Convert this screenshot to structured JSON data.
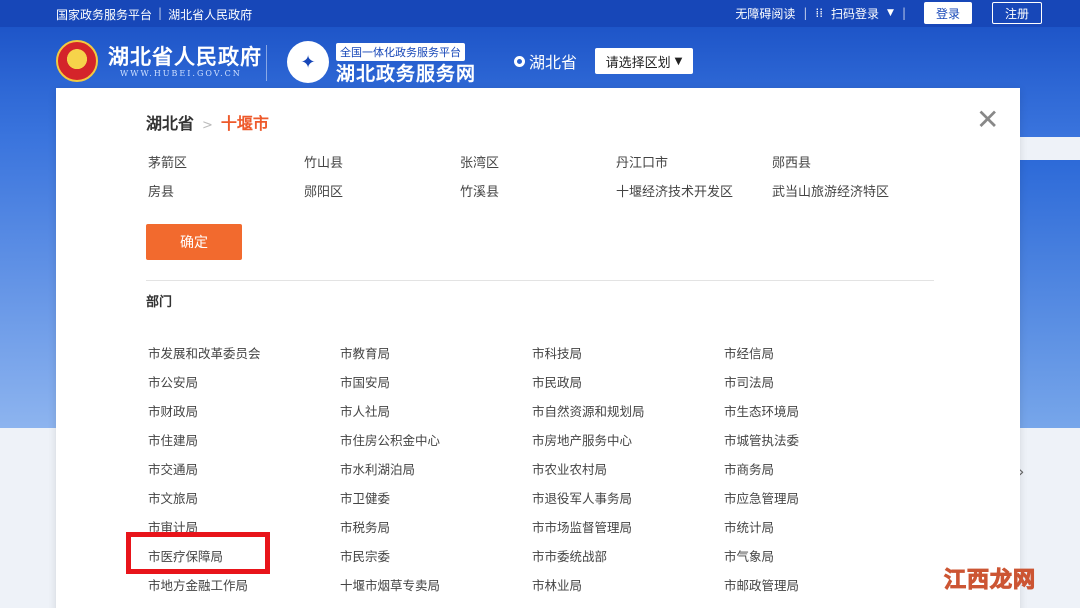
{
  "topbar": {
    "left_links": [
      "国家政务服务平台",
      "湖北省人民政府"
    ],
    "accessibility": "无障碍阅读",
    "scan_login": "扫码登录",
    "login": "登录",
    "register": "注册"
  },
  "header": {
    "gov_title": "湖北省人民政府",
    "gov_url": "WWW.HUBEI.GOV.CN",
    "service_tag": "全国一体化政务服务平台",
    "service_title": "湖北政务服务网",
    "region": "湖北省",
    "region_select": "请选择区划"
  },
  "modal": {
    "breadcrumb": {
      "province": "湖北省",
      "separator": ">",
      "city": "十堰市"
    },
    "districts": [
      "茅箭区",
      "竹山县",
      "张湾区",
      "丹江口市",
      "郧西县",
      "房县",
      "郧阳区",
      "竹溪县",
      "十堰经济技术开发区",
      "武当山旅游经济特区"
    ],
    "confirm": "确定",
    "departments_title": "部门",
    "departments": [
      "市发展和改革委员会",
      "市教育局",
      "市科技局",
      "市经信局",
      "市公安局",
      "市国安局",
      "市民政局",
      "市司法局",
      "市财政局",
      "市人社局",
      "市自然资源和规划局",
      "市生态环境局",
      "市住建局",
      "市住房公积金中心",
      "市房地产服务中心",
      "市城管执法委",
      "市交通局",
      "市水利湖泊局",
      "市农业农村局",
      "市商务局",
      "市文旅局",
      "市卫健委",
      "市退役军人事务局",
      "市应急管理局",
      "市审计局",
      "市税务局",
      "市市场监督管理局",
      "市统计局",
      "市医疗保障局",
      "市民宗委",
      "市市委统战部",
      "市气象局",
      "市地方金融工作局",
      "十堰市烟草专卖局",
      "市林业局",
      "市邮政管理局"
    ]
  },
  "watermark": "江西龙网",
  "colors": {
    "primary": "#1747b8",
    "accent": "#f26a2e",
    "highlight": "#e8141a"
  }
}
